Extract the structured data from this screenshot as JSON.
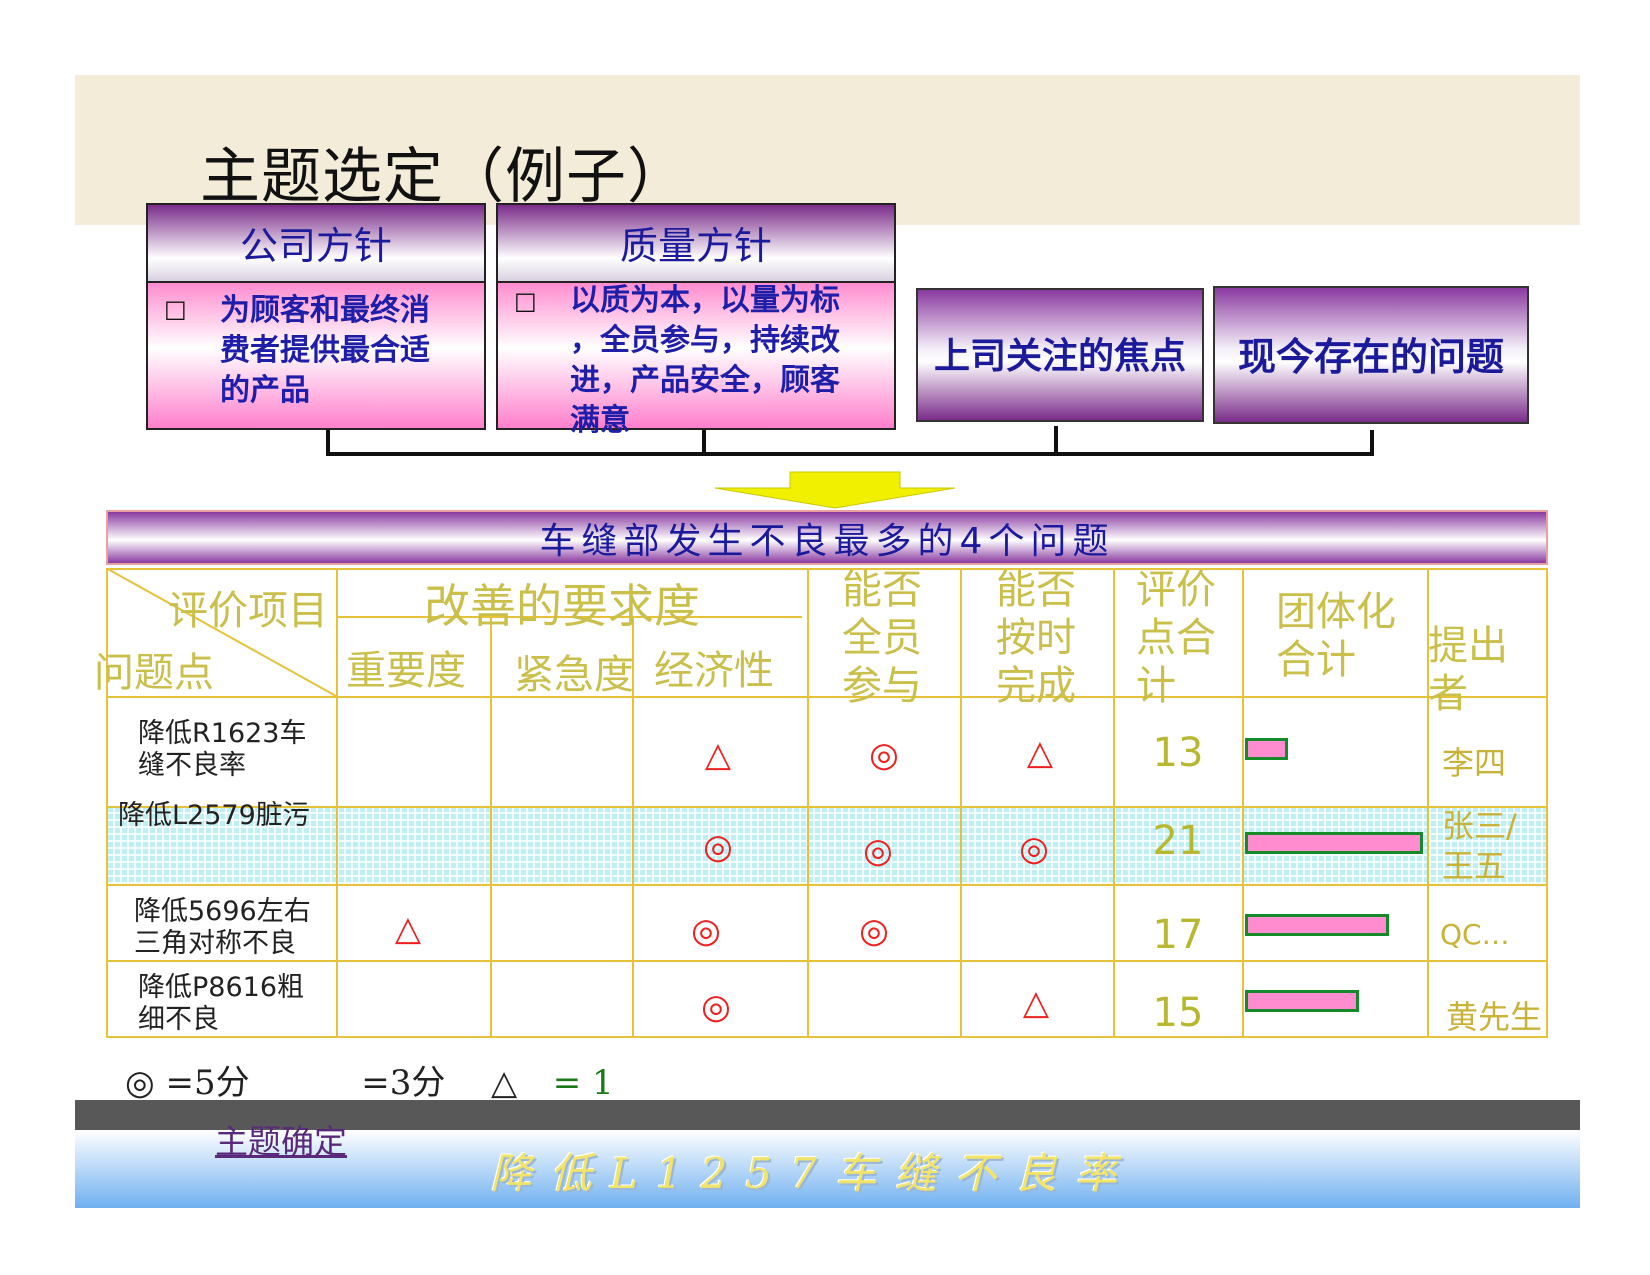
{
  "title": "主题选定（例子）",
  "policies": {
    "company": {
      "head": "公司方针",
      "checkbox": "□",
      "lines": [
        "为顾客和最终消",
        "费者提供最合适",
        "的产品"
      ]
    },
    "quality": {
      "head": "质量方针",
      "checkbox": "□",
      "lines": [
        "以质为本，以量为标",
        "，全员参与，持续改",
        "进，产品安全，顾客",
        "满意"
      ]
    }
  },
  "focus_boxes": [
    "上司关注的焦点",
    "现今存在的问题"
  ],
  "table": {
    "title": "车缝部发生不良最多的4个问题",
    "headers": {
      "eval_item": "评价项目",
      "problem": "问题点",
      "improvement": "改善的要求度",
      "importance": "重要度",
      "urgency": "紧急度",
      "economy": "经济性",
      "participation": [
        "能否",
        "全员",
        "参与"
      ],
      "ontime": [
        "能否",
        "按时",
        "完成"
      ],
      "score_total": [
        "评价",
        "点合",
        "计"
      ],
      "team_total": [
        "团体化",
        "合计"
      ],
      "proposer": [
        "提出",
        "者"
      ]
    },
    "rows": [
      {
        "label": [
          "降低R1623车",
          "缝不良率"
        ],
        "importance": "",
        "urgency": "",
        "economy": "△",
        "participation": "◎",
        "ontime": "△",
        "score": "13",
        "bar_fraction": 0.24,
        "proposer": [
          "李四"
        ]
      },
      {
        "label": [
          "降低L2579脏污"
        ],
        "importance": "",
        "urgency": "",
        "economy": "◎",
        "participation": "◎",
        "ontime": "◎",
        "score": "21",
        "bar_fraction": 1.0,
        "proposer": [
          "张三/",
          "王五"
        ]
      },
      {
        "label": [
          "降低5696左右",
          "三角对称不良"
        ],
        "importance": "△",
        "urgency": "",
        "economy": "◎",
        "participation": "◎",
        "ontime": "",
        "score": "17",
        "bar_fraction": 0.81,
        "proposer": [
          "QC…"
        ]
      },
      {
        "label": [
          "降低P8616粗",
          "细不良"
        ],
        "importance": "",
        "urgency": "",
        "economy": "◎",
        "participation": "",
        "ontime": "△",
        "score": "15",
        "bar_fraction": 0.64,
        "proposer": [
          "黄先生"
        ]
      }
    ]
  },
  "legend": {
    "five": "◎ =5分",
    "three": "=3分",
    "one_symbol": "△",
    "one_eq": "= 1"
  },
  "footer": {
    "link": "主题确定",
    "banner": "降低L1257车缝不良率"
  },
  "colors": {
    "mark": "#ee2020",
    "bar_fill": "#ff8ccf",
    "bar_border": "#158a2a",
    "grid": "#e6c23a",
    "header_text": "#c9bf4a"
  }
}
